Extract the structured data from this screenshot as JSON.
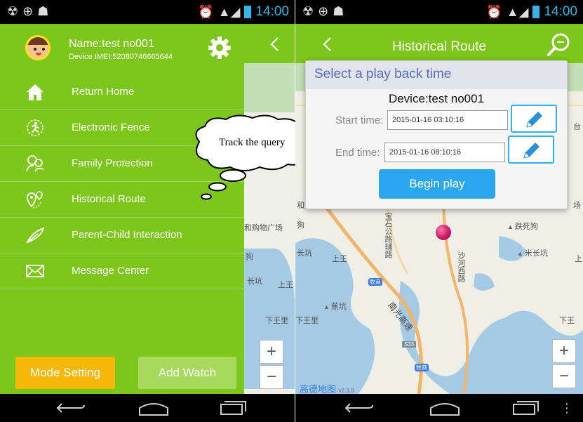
{
  "status_bar": {
    "time_left": "14:00",
    "time_right": "14:00"
  },
  "drawer": {
    "profile": {
      "name": "Name:test no001",
      "imei": "Device IMEI:52080746665644"
    },
    "menu": [
      {
        "label": "Return Home",
        "icon": "home-icon"
      },
      {
        "label": "Electronic Fence",
        "icon": "fence-runner-icon"
      },
      {
        "label": "Family Protection",
        "icon": "family-protection-icon"
      },
      {
        "label": "Historical Route",
        "icon": "location-pins-icon"
      },
      {
        "label": "Parent-Child Interaction",
        "icon": "feather-icon"
      },
      {
        "label": "Message Center",
        "icon": "envelope-icon"
      }
    ],
    "mode_setting_label": "Mode Setting",
    "add_watch_label": "Add Watch"
  },
  "left_map_labels": [
    "和购物广场",
    "狗",
    "长坑",
    "上王",
    "下王里"
  ],
  "annotation": {
    "bubble_text": "Track the query"
  },
  "route_screen": {
    "title": "Historical Route",
    "dialog": {
      "title": "Select a play back time",
      "device": "Device:test no001",
      "start_label": "Start time:",
      "start_value": "2015-01-16 03:10:16",
      "end_label": "End time:",
      "end_value": "2015-01-16 08:10:16",
      "play_label": "Begin play"
    },
    "map_labels": {
      "shopping": "和购物广场",
      "dog": "狗",
      "changkeng_left": "长坑",
      "shangwang": "上王",
      "baoshi_road": "宝石公路辅路",
      "diesigou": "跌死狗",
      "michangkeng": "米长坑",
      "shang_right": "上",
      "muchang1": "牧商",
      "shahexi": "沙河西路",
      "jiaokeng": "蕉坑",
      "xiawangli": "下王里",
      "xiawang_right": "下王",
      "highway": "南光高速",
      "muchang2": "牧商",
      "taiding": "台",
      "chang_right": "场",
      "road_shield": "S33"
    },
    "zoom_in": "+",
    "zoom_out": "−",
    "map_logo": "高德地图",
    "map_logo_version": "v2.3.0"
  },
  "colors": {
    "brand_green": "#7dc61c",
    "mode_orange": "#f7b70a",
    "add_light_green": "#a6d95c",
    "accent_blue": "#2aa7ef",
    "dialog_title": "#5a6bb8"
  }
}
